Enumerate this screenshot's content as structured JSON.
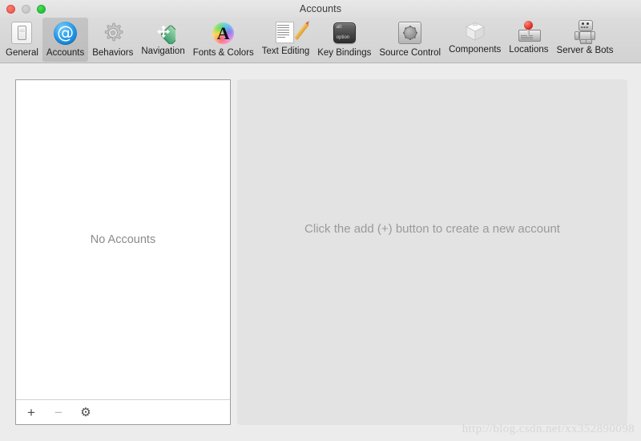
{
  "window": {
    "title": "Accounts",
    "traffic_lights": [
      {
        "name": "close",
        "color": "#ec5f55",
        "label": "Close"
      },
      {
        "name": "minimize",
        "color": "#c6c6c6",
        "label": "Minimize"
      },
      {
        "name": "zoom",
        "color": "#23c03a",
        "label": "Zoom"
      }
    ]
  },
  "toolbar": {
    "selected": "Accounts",
    "items": [
      {
        "label": "General",
        "icon": "general-switch-icon",
        "selected": false
      },
      {
        "label": "Accounts",
        "icon": "at-sign-icon",
        "selected": true
      },
      {
        "label": "Behaviors",
        "icon": "gear-icon",
        "selected": false
      },
      {
        "label": "Navigation",
        "icon": "navigation-arrows-icon",
        "selected": false
      },
      {
        "label": "Fonts & Colors",
        "icon": "color-wheel-a-icon",
        "selected": false
      },
      {
        "label": "Text Editing",
        "icon": "document-pencil-icon",
        "selected": false
      },
      {
        "label": "Key Bindings",
        "icon": "keyboard-key-icon",
        "selected": false
      },
      {
        "label": "Source Control",
        "icon": "safe-vault-icon",
        "selected": false
      },
      {
        "label": "Components",
        "icon": "cube-icon",
        "selected": false
      },
      {
        "label": "Locations",
        "icon": "hard-drive-pin-icon",
        "selected": false
      },
      {
        "label": "Server & Bots",
        "icon": "robot-icon",
        "selected": false
      }
    ],
    "key_bindings_icon_text": {
      "line1": "alt",
      "line2": "option"
    }
  },
  "accounts_panel": {
    "empty_message": "No Accounts",
    "footer": {
      "add_label": "+",
      "remove_label": "−",
      "settings_label": "⚙"
    }
  },
  "detail_panel": {
    "hint": "Click the add (+) button to create a new account"
  },
  "watermark": {
    "text": "http://blog.csdn.net/xx352890098"
  },
  "colors": {
    "window_bg": "#ececec",
    "toolbar_bg": "#d6d6d6",
    "panel_bg": "#ffffff",
    "detail_bg": "#e3e3e3",
    "accent_blue": "#2196e8",
    "muted_text": "#8b8b8b"
  }
}
